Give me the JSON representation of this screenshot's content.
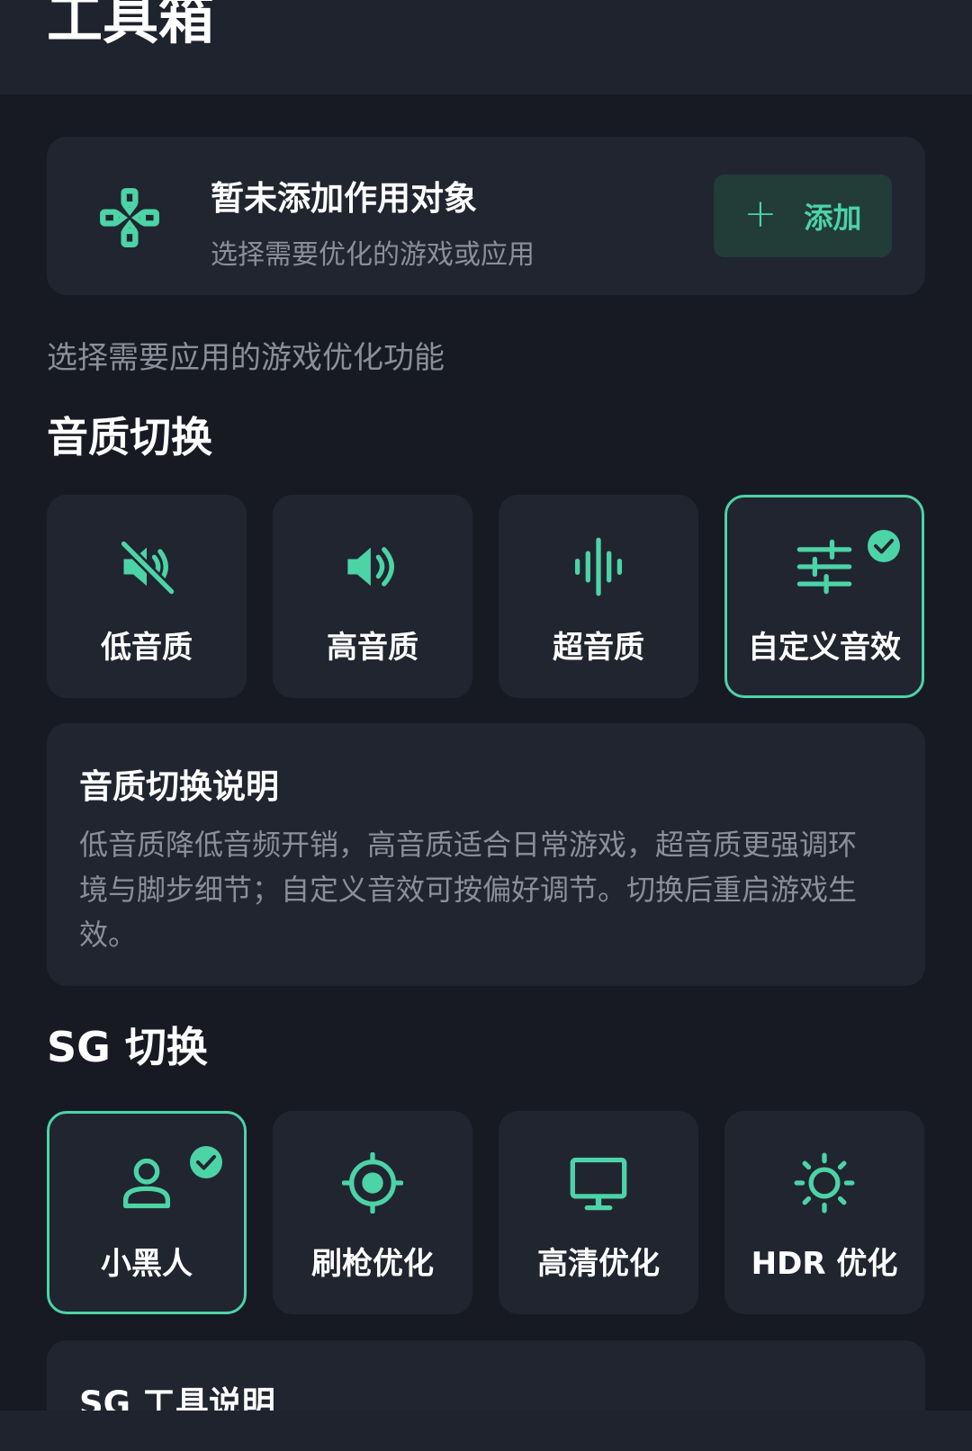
{
  "header": {
    "title": "工具箱"
  },
  "target": {
    "title": "暂未添加作用对象",
    "subtitle": "选择需要优化的游戏或应用",
    "add_button": {
      "icon": "plus-icon",
      "plus": "+",
      "label": "添加"
    }
  },
  "hint": "选择需要应用的游戏优化功能",
  "sound": {
    "heading": "音质切换",
    "options": [
      {
        "label": "低音质",
        "icon": "speaker-muted-icon",
        "selected": false
      },
      {
        "label": "高音质",
        "icon": "speaker-icon",
        "selected": false
      },
      {
        "label": "超音质",
        "icon": "sound-wave-icon",
        "selected": false
      },
      {
        "label": "自定义音效",
        "icon": "sliders-icon",
        "selected": true
      }
    ],
    "info": {
      "title": "音质切换说明",
      "body": "低音质降低音频开销，高音质适合日常游戏，超音质更强调环境与脚步细节；自定义音效可按偏好调节。切换后重启游戏生效。"
    }
  },
  "sg": {
    "heading": "SG 切换",
    "options": [
      {
        "label": "小黑人",
        "icon": "person-icon",
        "selected": true
      },
      {
        "label": "刷枪优化",
        "icon": "crosshair-icon",
        "selected": false
      },
      {
        "label": "高清优化",
        "icon": "monitor-icon",
        "selected": false
      },
      {
        "label": "HDR 优化",
        "icon": "sun-icon",
        "selected": false
      }
    ],
    "info": {
      "title": "SG 工具说明"
    }
  },
  "colors": {
    "accent": "#4cd3a6",
    "background": "#171a23",
    "card": "#21252f",
    "muted_text": "#8a8f99"
  }
}
